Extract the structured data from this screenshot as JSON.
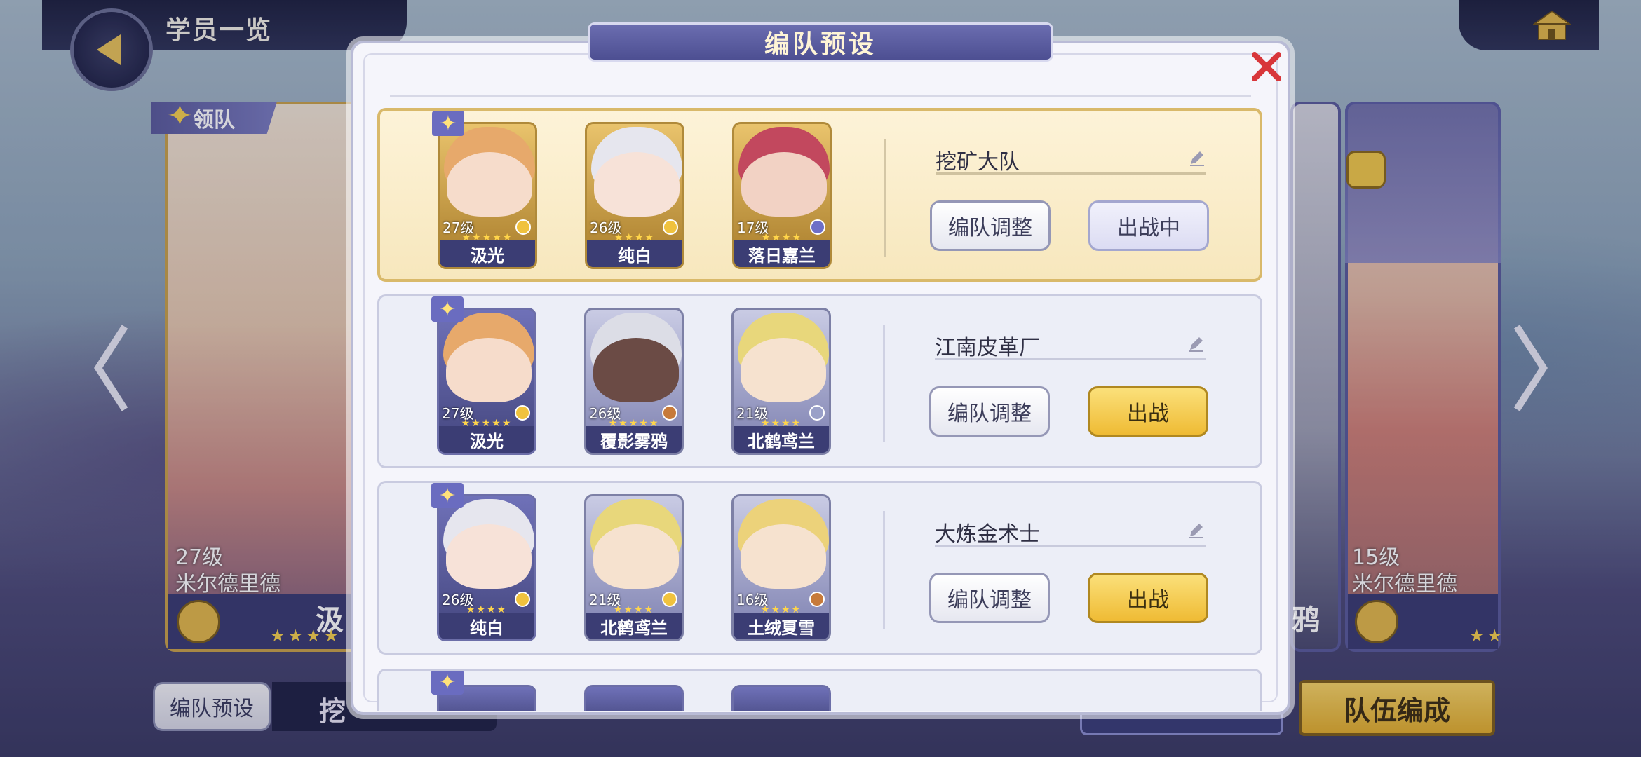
{
  "background": {
    "page_title": "学员一览",
    "leader_tag": "领队",
    "leader_card": {
      "level": "27级",
      "name": "米尔德里德",
      "part_name": "汲",
      "stars": "★★★★"
    },
    "right_card": {
      "level": "15级",
      "name": "米尔德里德",
      "stars": "★★"
    },
    "mid_card_text": "鸦",
    "bottom_left_button": "编队预设",
    "bottom_left_team": "挖",
    "formation_button": "队伍编成"
  },
  "modal": {
    "title": "编队预设",
    "teams": [
      {
        "name": "挖矿大队",
        "adjust_label": "编队调整",
        "deploy_label": "出战中",
        "deployed": true,
        "members": [
          {
            "level": "27级",
            "stars": "★★★★★",
            "name": "汲光"
          },
          {
            "level": "26级",
            "stars": "★★★★",
            "name": "纯白"
          },
          {
            "level": "17级",
            "stars": "★★★★",
            "name": "落日嘉兰"
          }
        ]
      },
      {
        "name": "江南皮革厂",
        "adjust_label": "编队调整",
        "deploy_label": "出战",
        "deployed": false,
        "members": [
          {
            "level": "27级",
            "stars": "★★★★★",
            "name": "汲光"
          },
          {
            "level": "26级",
            "stars": "★★★★★",
            "name": "覆影雾鸦"
          },
          {
            "level": "21级",
            "stars": "★★★★",
            "name": "北鹤鸢兰"
          }
        ]
      },
      {
        "name": "大炼金术士",
        "adjust_label": "编队调整",
        "deploy_label": "出战",
        "deployed": false,
        "members": [
          {
            "level": "26级",
            "stars": "★★★★",
            "name": "纯白"
          },
          {
            "level": "21级",
            "stars": "★★★★",
            "name": "北鹤鸢兰"
          },
          {
            "level": "16级",
            "stars": "★★★★",
            "name": "土绒夏雪"
          }
        ]
      }
    ]
  },
  "colors": {
    "accent_gold": "#efbb34",
    "header_purple": "#4d4f92",
    "close_red": "#d8363a"
  },
  "icons": {
    "leader": "sparkle-star-icon",
    "edit": "pencil-icon",
    "close": "close-x-icon",
    "home": "home-icon",
    "back": "back-arrow-icon"
  }
}
